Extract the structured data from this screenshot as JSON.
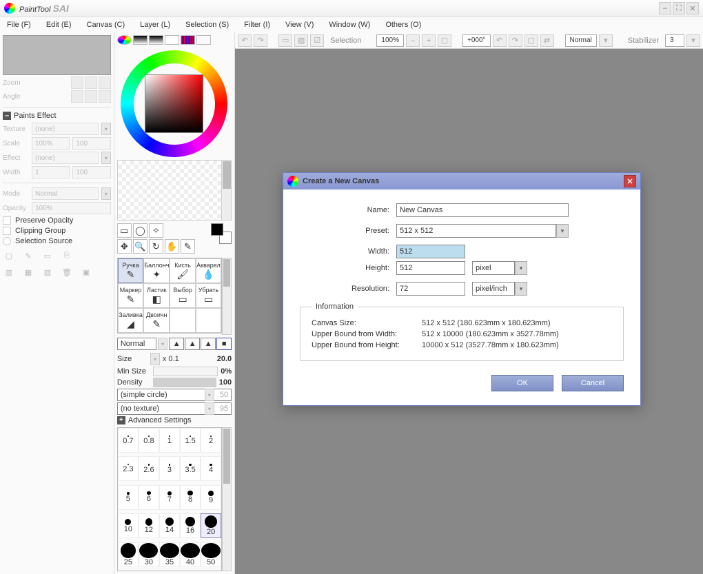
{
  "app": {
    "title": "PaintTool",
    "title_bold": "SAI"
  },
  "menu": {
    "file": "File (F)",
    "edit": "Edit (E)",
    "canvas": "Canvas (C)",
    "layer": "Layer (L)",
    "selection": "Selection (S)",
    "filter": "Filter (I)",
    "view": "View (V)",
    "window": "Window (W)",
    "others": "Others (O)"
  },
  "left": {
    "zoom": "Zoom",
    "angle": "Angle",
    "paints_effect": "Paints Effect",
    "texture": "Texture",
    "texture_val": "(none)",
    "scale": "Scale",
    "scale_val": "100%",
    "scale_num": "100",
    "effect": "Effect",
    "effect_val": "(none)",
    "width": "Width",
    "width_val": "1",
    "width_num": "100",
    "mode": "Mode",
    "mode_val": "Normal",
    "opacity": "Opacity",
    "opacity_val": "100%",
    "preserve": "Preserve Opacity",
    "clipping": "Clipping Group",
    "selsrc": "Selection Source"
  },
  "mid": {
    "normal": "Normal",
    "size": "Size",
    "size_mult": "x 0.1",
    "size_val": "20.0",
    "minsize": "Min Size",
    "minsize_val": "0%",
    "density": "Density",
    "density_val": "100",
    "shape": "(simple circle)",
    "shape_n": "50",
    "texture": "(no texture)",
    "texture_n": "95",
    "advanced": "Advanced Settings"
  },
  "brushes": [
    "Ручка",
    "Баллонч",
    "Кисть",
    "Акварел",
    "Маркер",
    "Ластик",
    "Выбор",
    "Убрать",
    "Заливка",
    "Двоичн"
  ],
  "brush_icons": [
    "✎",
    "✦",
    "🖌",
    "💧",
    "✎",
    "◧",
    "▭",
    "▭",
    "◢",
    "✎"
  ],
  "dots": [
    0.7,
    0.8,
    1,
    1.5,
    2,
    2.3,
    2.6,
    3,
    3.5,
    4,
    5,
    6,
    7,
    8,
    9,
    10,
    12,
    14,
    16,
    20,
    25,
    30,
    35,
    40,
    50
  ],
  "dot_sel": 19,
  "toolbar": {
    "selection": "Selection",
    "zoom": "100%",
    "angle": "+000°",
    "blend": "Normal",
    "stabilizer_lbl": "Stabilizer",
    "stabilizer": "3"
  },
  "dialog": {
    "title": "Create a New Canvas",
    "name_l": "Name:",
    "name": "New Canvas",
    "preset_l": "Preset:",
    "preset": "512 x  512",
    "width_l": "Width:",
    "width": "512",
    "height_l": "Height:",
    "height": "512",
    "unit": "pixel",
    "res_l": "Resolution:",
    "res": "72",
    "res_unit": "pixel/inch",
    "info": "Information",
    "canvas_size_l": "Canvas Size:",
    "canvas_size": "512 x 512 (180.623mm x 180.623mm)",
    "ubw_l": "Upper Bound from Width:",
    "ubw": "512 x 10000 (180.623mm x 3527.78mm)",
    "ubh_l": "Upper Bound from Height:",
    "ubh": "10000 x 512 (3527.78mm x 180.623mm)",
    "ok": "OK",
    "cancel": "Cancel"
  }
}
